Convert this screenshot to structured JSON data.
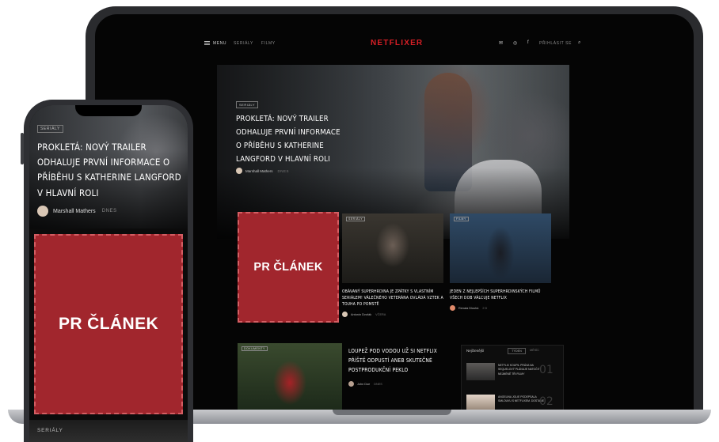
{
  "nav": {
    "menu": "MENU",
    "items": [
      "SERIÁLY",
      "FILMY"
    ],
    "logo": "NETFLIXER",
    "login": "PŘIHLÁSIT SE",
    "icons": [
      "mail-icon",
      "instagram-icon",
      "facebook-icon",
      "search-icon"
    ]
  },
  "hero": {
    "category": "SERIÁLY",
    "title": "PROKLETÁ: NOVÝ TRAILER ODHALUJE PRVNÍ INFORMACE O PŘÍBĚHU S KATHERINE LANGFORD V HLAVNÍ ROLI",
    "author": "Marshall Mathers",
    "date": "DNES"
  },
  "pr": {
    "label": "PR ČLÁNEK"
  },
  "cards": [
    {
      "category": "SERIÁLY",
      "title": "OBÁVANÝ SUPERHRDINA JE ZPÁTKY S VLASTNÍM SERIÁLEM! VÁLEČNÉHO VETERÁNA OVLÁDÁ VZTEK A TOUHA PO POMSTĚ",
      "author": "Antonín Dvořák",
      "date": "VČERA"
    },
    {
      "category": "FILMY",
      "title": "JEDEN Z NEJLEPŠÍCH SUPERHRDINSKÝCH FILMŮ VŠECH DOB VÁLCUJE NETFLIX",
      "author": "Renata Dlouhá",
      "date": "2 D"
    }
  ],
  "bottom_article": {
    "category": "DOKUMENTY",
    "title": "LOUPEŽ POD VODOU UŽ SI NETFLIX PŘÍŠTĚ ODPUSTÍ ANEB SKUTEČNÉ POSTPRODUKČNÍ PEKLO",
    "author": "John Doe",
    "date": "DNES"
  },
  "popular": {
    "heading": "Nejčtenější",
    "tabs": [
      "TÝDEN",
      "MĚSÍC"
    ],
    "items": [
      {
        "num": "01",
        "title": "NETFLIX KOUPIL PRÁVA NA SEQUELOVÝ PLÁNUJE NATOČIT NEJMÉNĚ TŘI FILMY"
      },
      {
        "num": "02",
        "title": "ANGELINA JOLIE PODEPSALA SMLOUVU S NETFLIXEM. DOSTANE"
      }
    ]
  },
  "phone": {
    "bottom_category": "SERIÁLY"
  },
  "colors": {
    "brand_red": "#d81f26",
    "pr_red": "#a1262d"
  }
}
